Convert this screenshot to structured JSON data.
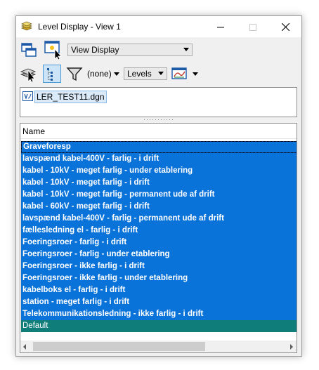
{
  "window": {
    "title": "Level Display - View 1",
    "controls": {
      "minimize": "—",
      "maximize": "☐",
      "close": "✕"
    }
  },
  "toolbar1": {
    "view_display_select": "View Display"
  },
  "toolbar2": {
    "filter_label": "(none)",
    "levels_select": "Levels"
  },
  "files": [
    {
      "name": "LER_TEST11.dgn"
    }
  ],
  "list": {
    "column_header": "Name",
    "rows": [
      "Graveforesp",
      "lavspænd kabel-400V - farlig - i drift",
      "kabel - 10kV - meget farlig - under etablering",
      "kabel - 10kV - meget farlig - i drift",
      "kabel - 10kV - meget farlig - permanent ude af drift",
      "kabel - 60kV - meget farlig - i drift",
      "lavspænd kabel-400V - farlig - permanent ude af drift",
      "fællesledning el - farlig - i drift",
      "Foeringsroer - farlig - i drift",
      "Foeringsroer - farlig - under etablering",
      "Foeringsroer - ikke farlig - i drift",
      "Foeringsroer - ikke farlig - under etablering",
      "kabelboks el - farlig - i drift",
      "station - meget farlig - i drift",
      "Telekommunikationsledning - ikke farlig - i drift",
      "Default"
    ]
  },
  "colors": {
    "selection": "#0a73d9",
    "default_row": "#0f7d79",
    "tool_highlight": "#cce4f7"
  },
  "icons": {
    "title": "stacked-layers-icon",
    "tools": [
      "view-windows-icon",
      "highlight-cursor-icon",
      "layer-cursor-icon",
      "tree-list-icon",
      "filter-funnel-icon",
      "display-style-icon"
    ]
  }
}
